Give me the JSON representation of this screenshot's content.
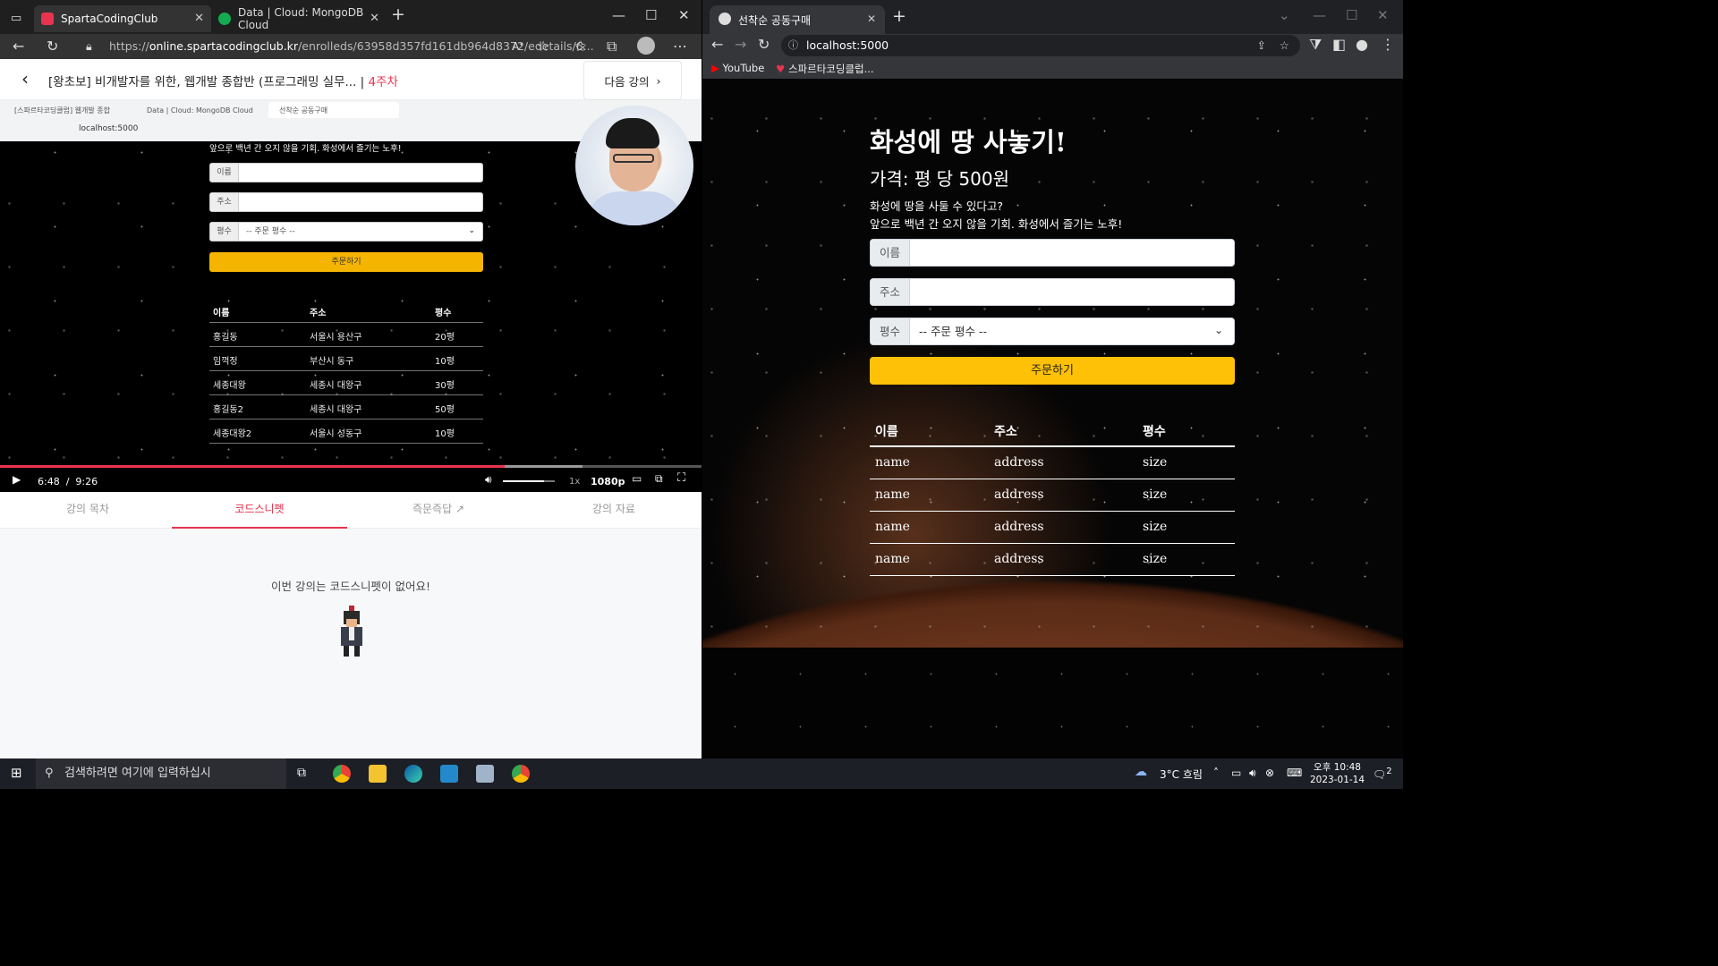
{
  "edge": {
    "tabs": [
      {
        "label": "SpartaCodingClub",
        "active": true
      },
      {
        "label": "Data | Cloud: MongoDB Cloud",
        "active": false
      }
    ],
    "url_prefix": "https://",
    "url_host": "online.spartacodingclub.kr",
    "url_path": "/enrolleds/63958d357fd161db964d8372/edetails/6..."
  },
  "lecture": {
    "title": "[왕초보] 비개발자를 위한, 웹개발 종합반 (프로그래밍 실무...",
    "week": "4주차",
    "next_label": "다음 강의"
  },
  "video": {
    "inner_tabs": [
      "[스파르타코딩클럽] 웹개발 종합",
      "Data | Cloud: MongoDB Cloud",
      "선착순 공동구매"
    ],
    "inner_url": "localhost:5000",
    "inner_desc": "앞으로 백년 간 오지 않을 기회. 화성에서 즐기는 노후!",
    "inner_name_label": "이름",
    "inner_addr_label": "주소",
    "inner_size_label": "평수",
    "inner_size_placeholder": "-- 주문 평수 --",
    "inner_order": "주문하기",
    "inner_headers": [
      "이름",
      "주소",
      "평수"
    ],
    "inner_rows": [
      [
        "홍길동",
        "서울시 용산구",
        "20평"
      ],
      [
        "임꺽정",
        "부산시 동구",
        "10평"
      ],
      [
        "세종대왕",
        "세종시 대왕구",
        "30평"
      ],
      [
        "홍길동2",
        "세종시 대왕구",
        "50평"
      ],
      [
        "세종대왕2",
        "서울시 성동구",
        "10평"
      ]
    ],
    "current_time": "6:48",
    "duration": "9:26",
    "played_fraction": 0.72,
    "buffered_fraction": 0.83,
    "volume_fraction": 0.8,
    "speed": "1x",
    "quality": "1080p"
  },
  "lecture_tabs": [
    "강의 목차",
    "코드스니펫",
    "즉문즉답",
    "강의 자료"
  ],
  "snippet_empty": "이번 강의는 코드스니펫이 없어요!",
  "chrome": {
    "tab_label": "선착순 공동구매",
    "url": "localhost:5000",
    "bookmarks": [
      "YouTube",
      "스파르타코딩클럽..."
    ]
  },
  "page": {
    "title": "화성에 땅 사놓기!",
    "price": "가격: 평 당 500원",
    "desc1": "화성에 땅을 사둘 수 있다고?",
    "desc2": "앞으로 백년 간 오지 않을 기회. 화성에서 즐기는 노후!",
    "name_label": "이름",
    "addr_label": "주소",
    "size_label": "평수",
    "size_placeholder": "-- 주문 평수 --",
    "order_button": "주문하기",
    "table_headers": [
      "이름",
      "주소",
      "평수"
    ],
    "rows": [
      [
        "name",
        "address",
        "size"
      ],
      [
        "name",
        "address",
        "size"
      ],
      [
        "name",
        "address",
        "size"
      ],
      [
        "name",
        "address",
        "size"
      ]
    ]
  },
  "taskbar": {
    "search_placeholder": "검색하려면 여기에 입력하십시",
    "weather": "3°C 흐림",
    "time": "오후 10:48",
    "date": "2023-01-14",
    "notifications": "2"
  },
  "colors": {
    "accent": "#e8344e",
    "order_button": "#ffc107",
    "inner_order_button": "#f4b400"
  }
}
